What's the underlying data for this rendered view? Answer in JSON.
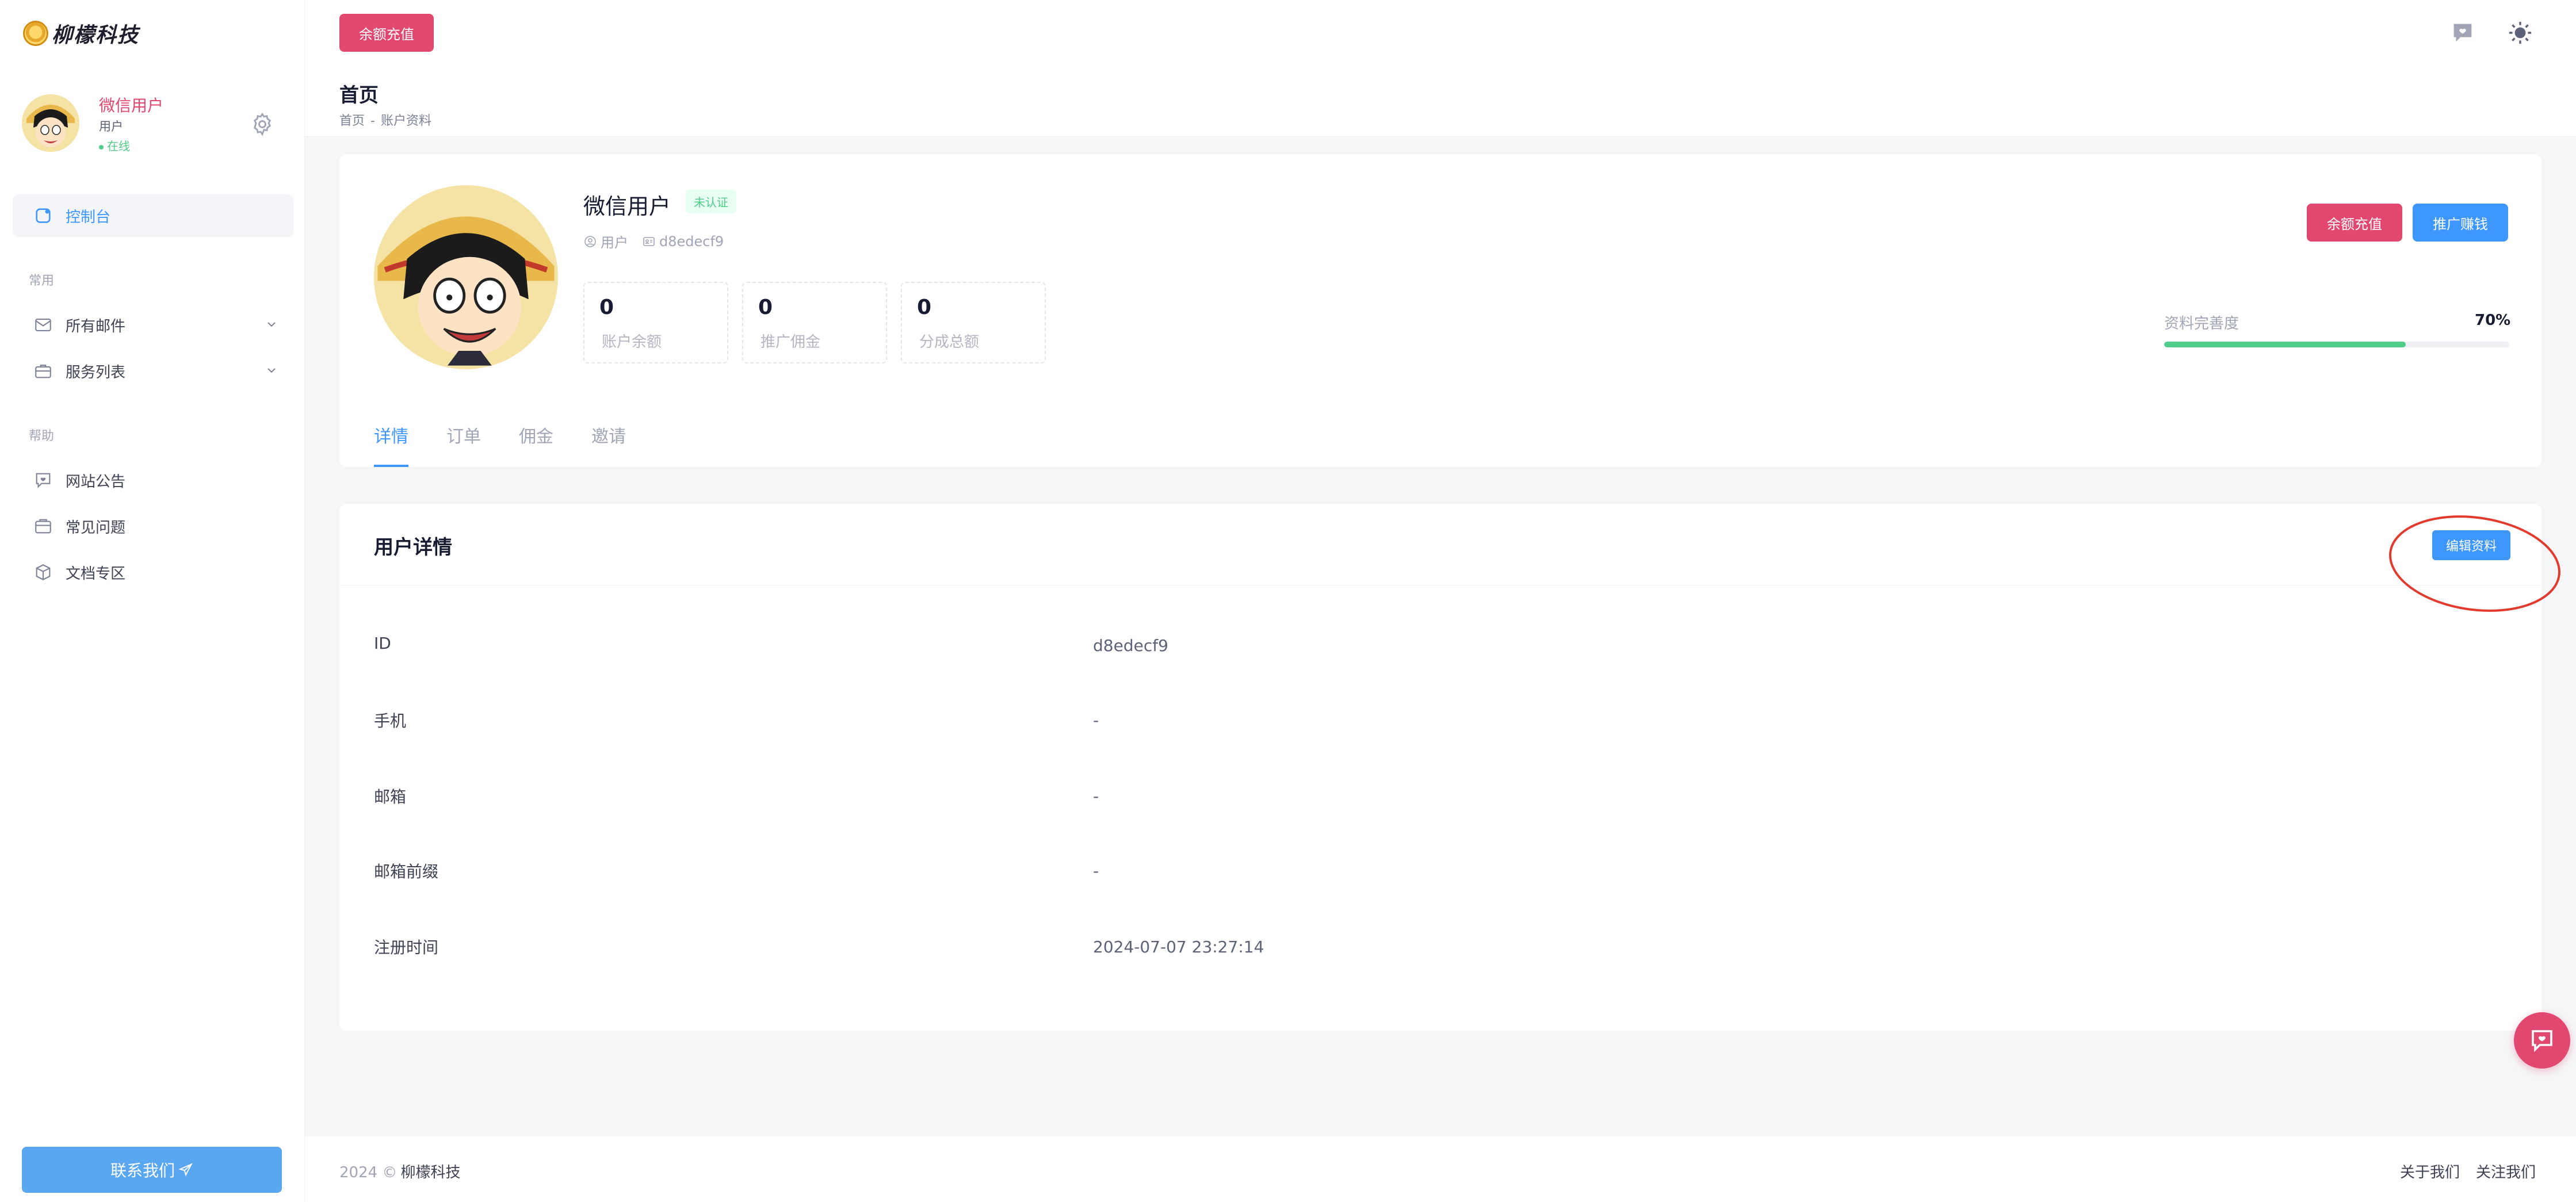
{
  "brand": {
    "name": "柳檬科技"
  },
  "sidebar": {
    "user": {
      "name": "微信用户",
      "role": "用户",
      "status": "在线"
    },
    "dashboard": "控制台",
    "section_common": "常用",
    "section_help": "帮助",
    "items": [
      {
        "label": "所有邮件",
        "icon": "mail-icon"
      },
      {
        "label": "服务列表",
        "icon": "briefcase-icon"
      },
      {
        "label": "网站公告",
        "icon": "announcement-icon"
      },
      {
        "label": "常见问题",
        "icon": "faq-icon"
      },
      {
        "label": "文档专区",
        "icon": "docs-icon"
      }
    ],
    "contact": "联系我们"
  },
  "topbar": {
    "recharge": "余额充值"
  },
  "subheader": {
    "title": "首页",
    "crumb_home": "首页",
    "crumb_sep": "-",
    "crumb_current": "账户资料"
  },
  "profile": {
    "name": "微信用户",
    "badge": "未认证",
    "role": "用户",
    "id": "d8edecf9",
    "stats": [
      {
        "value": "0",
        "label": "账户余额"
      },
      {
        "value": "0",
        "label": "推广佣金"
      },
      {
        "value": "0",
        "label": "分成总额"
      }
    ],
    "recharge": "余额充值",
    "promote": "推广赚钱",
    "progress_label": "资料完善度",
    "progress_text": "70%",
    "progress_value": 0.7,
    "tabs": [
      "详情",
      "订单",
      "佣金",
      "邀请"
    ]
  },
  "details": {
    "title": "用户详情",
    "edit": "编辑资料",
    "rows": [
      {
        "label": "ID",
        "value": "d8edecf9"
      },
      {
        "label": "手机",
        "value": "-"
      },
      {
        "label": "邮箱",
        "value": "-"
      },
      {
        "label": "邮箱前缀",
        "value": "-"
      },
      {
        "label": "注册时间",
        "value": "2024-07-07 23:27:14"
      }
    ]
  },
  "footer": {
    "year": "2024 ©",
    "company": "柳檬科技",
    "about": "关于我们",
    "follow": "关注我们"
  },
  "colors": {
    "accent": "#3e97ff",
    "brand_pink": "#e2476f",
    "success": "#50cd89"
  }
}
